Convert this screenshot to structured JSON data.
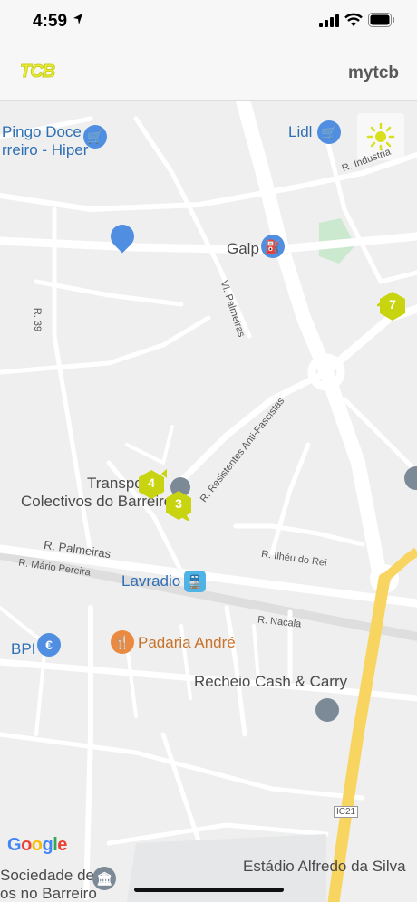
{
  "status_bar": {
    "time": "4:59"
  },
  "header": {
    "logo_text": "TCB",
    "account_label": "mytcb"
  },
  "map": {
    "places": {
      "pingo_doce_line1": "Pingo Doce",
      "pingo_doce_line2": "rreiro - Hiper",
      "lidl": "Lidl",
      "galp": "Galp",
      "transportes_line1": "Transpo",
      "transportes_line2": "Colectivos do Barreiro",
      "lavradio": "Lavradio",
      "bpi": "BPI",
      "padaria": "Padaria André",
      "recheio": "Recheio Cash & Carry",
      "sociedade_line1": "Sociedade de",
      "sociedade_line2": "os no Barreiro",
      "estadio": "Estádio Alfredo da Silva"
    },
    "streets": {
      "r_industria": "R. Industria",
      "r_39": "R. 39",
      "vl_palmeiras": "Vl. Palmeiras",
      "r_resistentes": "R. Resistentes Anti-Fascistas",
      "r_palmeiras": "R. Palmeiras",
      "r_mario_pereira": "R. Mário Pereira",
      "r_ilheu": "R. Ilhéu do Rei",
      "r_nacala": "R. Nacala",
      "ic21": "IC21"
    },
    "stop_markers": [
      "4",
      "3",
      "7"
    ],
    "attribution": "Google",
    "colors": {
      "marker": "#c9d411",
      "road": "#ffffff",
      "highway": "#f7d560",
      "poi_blue": "#4f8ee0",
      "poi_orange": "#ea8a40",
      "poi_gray": "#7b8a96"
    }
  }
}
